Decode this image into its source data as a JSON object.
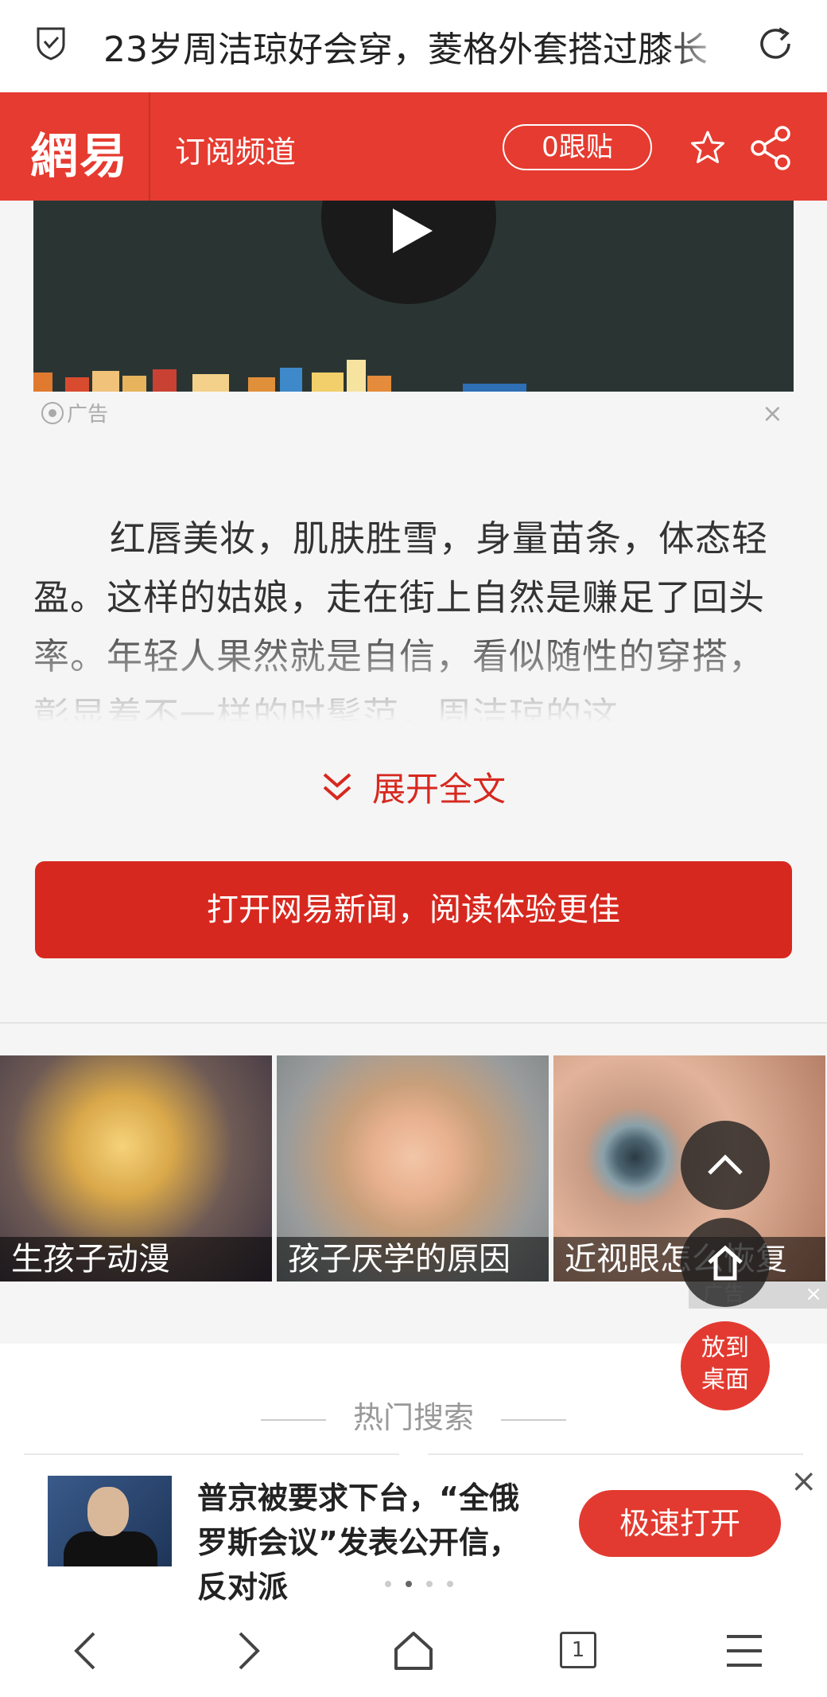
{
  "browser": {
    "page_title": "23岁周洁琼好会穿，菱格外套搭过膝长",
    "shield_icon": "shield-check-icon",
    "reload_icon": "reload-icon"
  },
  "header": {
    "logo": "網易",
    "channel": "订阅频道",
    "follow_label": "0跟贴",
    "star_icon": "star-icon",
    "share_icon": "share-icon",
    "accent": "#e63b30"
  },
  "ad": {
    "label": "广告",
    "close": "×"
  },
  "article": {
    "text": "红唇美妆，肌肤胜雪，身量苗条，体态轻盈。这样的姑娘，走在街上自然是赚足了回头率。年轻人果然就是自信，看似随性的穿搭，彰显着不一样的时髦范，周洁琼的这",
    "expand_label": "展开全文",
    "open_app_label": "打开网易新闻，阅读体验更佳"
  },
  "tiles": [
    {
      "caption": "生孩子动漫"
    },
    {
      "caption": "孩子厌学的原因"
    },
    {
      "caption": "近视眼怎么恢复"
    }
  ],
  "tile_ad": {
    "label": "广告",
    "close": "×"
  },
  "floating": {
    "desktop_label_1": "放到",
    "desktop_label_2": "桌面"
  },
  "hot_search": {
    "title": "热门搜索"
  },
  "banner": {
    "headline": "普京被要求下台，“全俄罗斯会议”发表公开信，反对派",
    "action_label": "极速打开",
    "close": "×"
  },
  "bottom_nav": {
    "tab_count": "1"
  }
}
